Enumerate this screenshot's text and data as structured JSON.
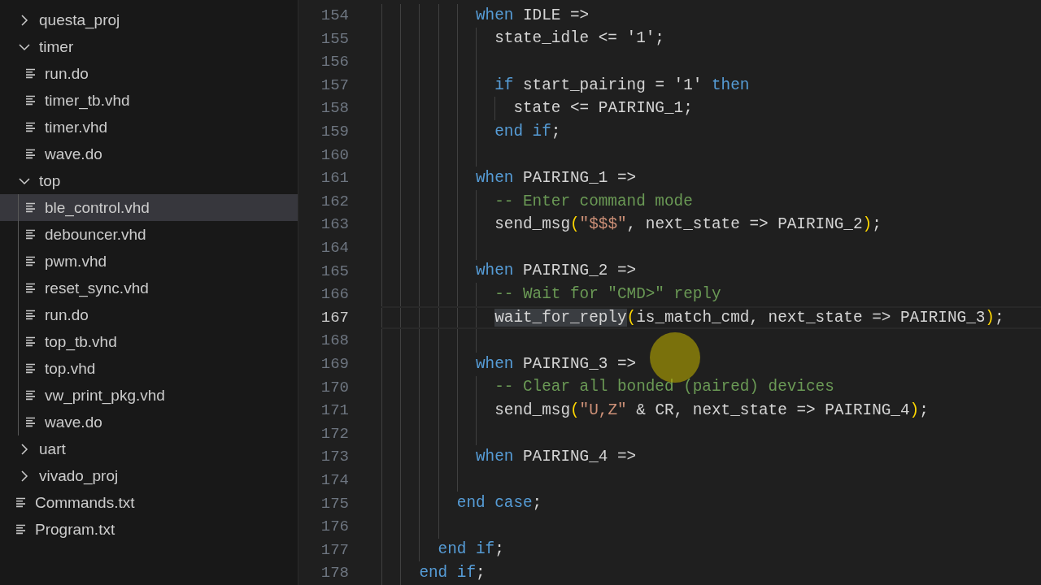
{
  "explorer": {
    "items": [
      {
        "kind": "folder",
        "label": "questa_proj",
        "expanded": false,
        "selected": false
      },
      {
        "kind": "folder",
        "label": "timer",
        "expanded": true,
        "selected": false,
        "children": [
          {
            "kind": "file",
            "label": "run.do",
            "selected": false
          },
          {
            "kind": "file",
            "label": "timer_tb.vhd",
            "selected": false
          },
          {
            "kind": "file",
            "label": "timer.vhd",
            "selected": false
          },
          {
            "kind": "file",
            "label": "wave.do",
            "selected": false
          }
        ]
      },
      {
        "kind": "folder",
        "label": "top",
        "expanded": true,
        "selected": false,
        "children": [
          {
            "kind": "file",
            "label": "ble_control.vhd",
            "selected": true
          },
          {
            "kind": "file",
            "label": "debouncer.vhd",
            "selected": false
          },
          {
            "kind": "file",
            "label": "pwm.vhd",
            "selected": false
          },
          {
            "kind": "file",
            "label": "reset_sync.vhd",
            "selected": false
          },
          {
            "kind": "file",
            "label": "run.do",
            "selected": false
          },
          {
            "kind": "file",
            "label": "top_tb.vhd",
            "selected": false
          },
          {
            "kind": "file",
            "label": "top.vhd",
            "selected": false
          },
          {
            "kind": "file",
            "label": "vw_print_pkg.vhd",
            "selected": false
          },
          {
            "kind": "file",
            "label": "wave.do",
            "selected": false
          }
        ]
      },
      {
        "kind": "folder",
        "label": "uart",
        "expanded": false,
        "selected": false
      },
      {
        "kind": "folder",
        "label": "vivado_proj",
        "expanded": false,
        "selected": false
      },
      {
        "kind": "file",
        "label": "Commands.txt",
        "selected": false
      },
      {
        "kind": "file",
        "label": "Program.txt",
        "selected": false
      }
    ]
  },
  "editor": {
    "lines": [
      {
        "number": "154",
        "current": false,
        "tokens": [
          {
            "kind": "keyword",
            "text": "          when"
          },
          {
            "kind": "plain",
            "text": " IDLE =>"
          }
        ]
      },
      {
        "number": "155",
        "current": false,
        "tokens": [
          {
            "kind": "plain",
            "text": "            state_idle <= '1';"
          }
        ]
      },
      {
        "number": "156",
        "current": false
      },
      {
        "number": "157",
        "current": false,
        "tokens": [
          {
            "kind": "keyword",
            "text": "            if"
          },
          {
            "kind": "plain",
            "text": " start_pairing = '1' "
          },
          {
            "kind": "keyword",
            "text": "then"
          }
        ]
      },
      {
        "number": "158",
        "current": false,
        "tokens": [
          {
            "kind": "plain",
            "text": "              state <= PAIRING_1;"
          }
        ]
      },
      {
        "number": "159",
        "current": false,
        "tokens": [
          {
            "kind": "keyword",
            "text": "            end if"
          },
          {
            "kind": "plain",
            "text": ";"
          }
        ]
      },
      {
        "number": "160",
        "current": false
      },
      {
        "number": "161",
        "current": false,
        "tokens": [
          {
            "kind": "keyword",
            "text": "          when"
          },
          {
            "kind": "plain",
            "text": " PAIRING_1 =>"
          }
        ]
      },
      {
        "number": "162",
        "current": false,
        "tokens": [
          {
            "kind": "comment",
            "text": "            -- Enter command mode"
          }
        ]
      },
      {
        "number": "163",
        "current": false,
        "tokens": [
          {
            "kind": "plain",
            "text": "            send_msg"
          },
          {
            "kind": "bracket",
            "text": "("
          },
          {
            "kind": "string",
            "text": "\"$$$\""
          },
          {
            "kind": "plain",
            "text": ", next_state => PAIRING_2"
          },
          {
            "kind": "bracket",
            "text": ")"
          },
          {
            "kind": "plain",
            "text": ";"
          }
        ]
      },
      {
        "number": "164",
        "current": false
      },
      {
        "number": "165",
        "current": false,
        "tokens": [
          {
            "kind": "keyword",
            "text": "          when"
          },
          {
            "kind": "plain",
            "text": " PAIRING_2 =>"
          }
        ]
      },
      {
        "number": "166",
        "current": false,
        "tokens": [
          {
            "kind": "comment",
            "text": "            -- Wait for \"CMD>\" reply"
          }
        ]
      },
      {
        "number": "167",
        "current": true,
        "tokens": [
          {
            "kind": "match",
            "text": "            wait_for_reply"
          },
          {
            "kind": "bracket",
            "text": "("
          },
          {
            "kind": "plain",
            "text": "is_match_cmd, next_state => PAIRING_3"
          },
          {
            "kind": "bracket",
            "text": ")"
          },
          {
            "kind": "plain",
            "text": ";"
          }
        ]
      },
      {
        "number": "168",
        "current": false
      },
      {
        "number": "169",
        "current": false,
        "tokens": [
          {
            "kind": "keyword",
            "text": "          when"
          },
          {
            "kind": "plain",
            "text": " PAIRING_3 =>"
          }
        ]
      },
      {
        "number": "170",
        "current": false,
        "tokens": [
          {
            "kind": "comment",
            "text": "            -- Clear all bonded (paired) devices"
          }
        ]
      },
      {
        "number": "171",
        "current": false,
        "tokens": [
          {
            "kind": "plain",
            "text": "            send_msg"
          },
          {
            "kind": "bracket",
            "text": "("
          },
          {
            "kind": "string",
            "text": "\"U,Z\""
          },
          {
            "kind": "plain",
            "text": " & CR, next_state => PAIRING_4"
          },
          {
            "kind": "bracket",
            "text": ")"
          },
          {
            "kind": "plain",
            "text": ";"
          }
        ]
      },
      {
        "number": "172",
        "current": false
      },
      {
        "number": "173",
        "current": false,
        "tokens": [
          {
            "kind": "keyword",
            "text": "          when"
          },
          {
            "kind": "plain",
            "text": " PAIRING_4 =>"
          }
        ]
      },
      {
        "number": "174",
        "current": false
      },
      {
        "number": "175",
        "current": false,
        "tokens": [
          {
            "kind": "keyword",
            "text": "        end case"
          },
          {
            "kind": "plain",
            "text": ";"
          }
        ]
      },
      {
        "number": "176",
        "current": false
      },
      {
        "number": "177",
        "current": false,
        "tokens": [
          {
            "kind": "keyword",
            "text": "      end if"
          },
          {
            "kind": "plain",
            "text": ";"
          }
        ]
      },
      {
        "number": "178",
        "current": false,
        "tokens": [
          {
            "kind": "keyword",
            "text": "    end if"
          },
          {
            "kind": "plain",
            "text": ";"
          }
        ]
      }
    ]
  }
}
